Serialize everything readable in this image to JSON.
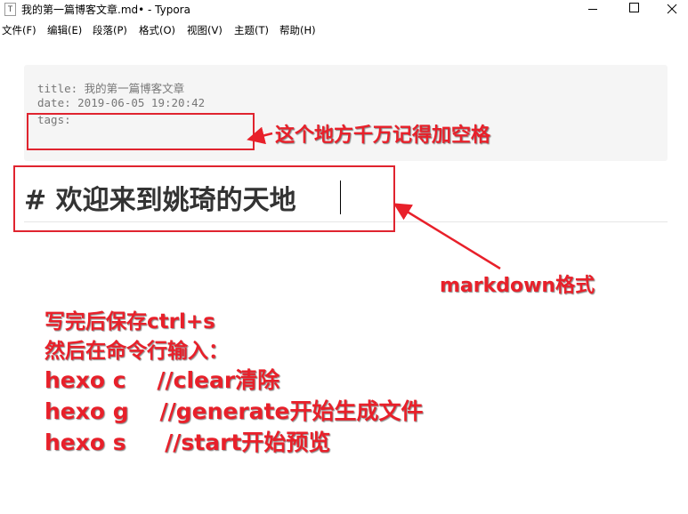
{
  "window": {
    "app_icon_glyph": "T",
    "title": "我的第一篇博客文章.md• - Typora"
  },
  "menu": [
    "文件(F)",
    "编辑(E)",
    "段落(P)",
    "格式(O)",
    "视图(V)",
    "主题(T)",
    "帮助(H)"
  ],
  "editor": {
    "front_matter": {
      "line1": "title: 我的第一篇博客文章",
      "line2": "date: 2019-06-05 19:20:42",
      "line3": "tags:"
    },
    "heading": "# 欢迎来到姚琦的天地"
  },
  "annotations": {
    "tags_note": "这个地方千万记得加空格",
    "markdown_note": "markdown格式",
    "instructions": [
      "写完后保存ctrl+s",
      "然后在命令行输入：",
      "hexo c    //clear清除",
      "hexo g    //generate开始生成文件",
      "hexo s     //start开始预览"
    ]
  },
  "colors": {
    "annotation_red": "#e8202a",
    "front_matter_bg": "#f5f5f5",
    "front_matter_text": "#777777",
    "heading_text": "#333333"
  }
}
